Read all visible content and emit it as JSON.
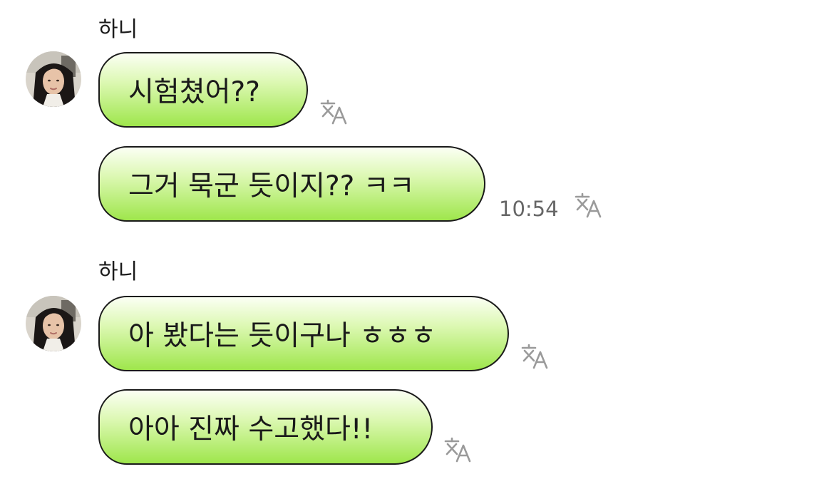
{
  "groups": [
    {
      "sender": "하니",
      "messages": [
        {
          "text": "시험쳤어??"
        },
        {
          "text": "그거 묵군 듯이지?? ㅋㅋ",
          "time": "10:54"
        }
      ]
    },
    {
      "sender": "하니",
      "messages": [
        {
          "text": "아 봤다는 듯이구나 ㅎㅎㅎ"
        },
        {
          "text": "아아 진짜 수고했다!!"
        }
      ]
    }
  ],
  "icons": {
    "avatar": "profile-photo",
    "translate": "translate-icon"
  },
  "colors": {
    "bubble_top": "#fbfff4",
    "bubble_bottom": "#9fe64c",
    "bubble_border": "#1a1a1a",
    "timestamp": "#666666",
    "icon_gray": "#9a9a9a"
  }
}
